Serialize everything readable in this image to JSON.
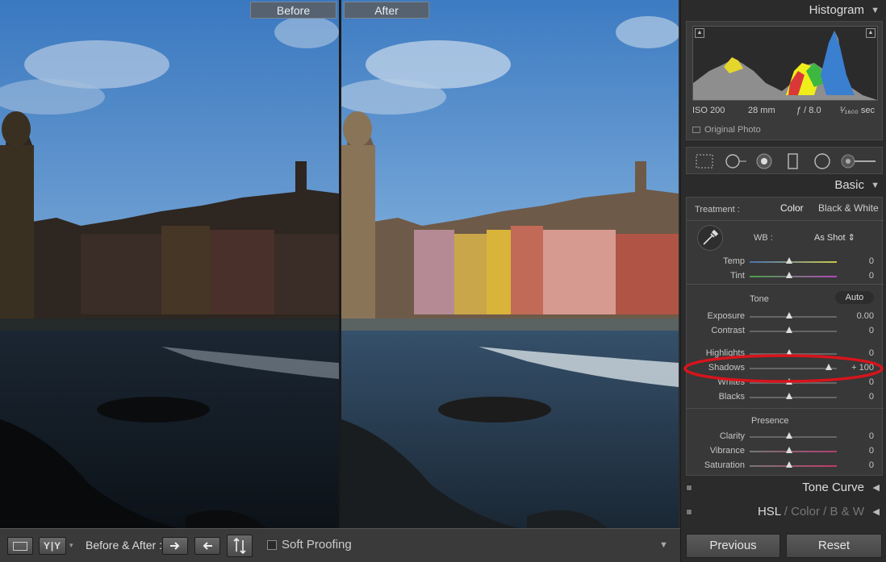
{
  "view": {
    "before_label": "Before",
    "after_label": "After"
  },
  "toolbar": {
    "yy_label": "Y|Y",
    "dropdown_glyph": "▾",
    "before_after_label": "Before & After :",
    "soft_proofing_label": "Soft Proofing",
    "menu_glyph": "▼"
  },
  "histogram": {
    "title": "Histogram",
    "collapse_glyph": "▼",
    "iso": "ISO 200",
    "focal": "28 mm",
    "aperture": "ƒ / 8.0",
    "shutter": "¹⁄₁₆₀₀ sec",
    "original_photo": "Original Photo"
  },
  "basic": {
    "title": "Basic",
    "collapse_glyph": "▼",
    "treatment_label": "Treatment :",
    "treatment_color": "Color",
    "treatment_bw": "Black & White",
    "wb_label": "WB :",
    "wb_value": "As Shot ⇕",
    "tone_label": "Tone",
    "auto_label": "Auto",
    "presence_label": "Presence",
    "sliders": [
      {
        "label": "Temp",
        "value": "0",
        "pos": 0.5,
        "track": "temp"
      },
      {
        "label": "Tint",
        "value": "0",
        "pos": 0.5,
        "track": "tint"
      },
      {
        "label": "Exposure",
        "value": "0.00",
        "pos": 0.5,
        "track": "plain"
      },
      {
        "label": "Contrast",
        "value": "0",
        "pos": 0.5,
        "track": "plain"
      },
      {
        "label": "Highlights",
        "value": "0",
        "pos": 0.5,
        "track": "plain"
      },
      {
        "label": "Shadows",
        "value": "+ 100",
        "pos": 1.0,
        "track": "plain"
      },
      {
        "label": "Whites",
        "value": "0",
        "pos": 0.5,
        "track": "plain"
      },
      {
        "label": "Blacks",
        "value": "0",
        "pos": 0.5,
        "track": "plain"
      },
      {
        "label": "Clarity",
        "value": "0",
        "pos": 0.5,
        "track": "plain"
      },
      {
        "label": "Vibrance",
        "value": "0",
        "pos": 0.5,
        "track": "vib"
      },
      {
        "label": "Saturation",
        "value": "0",
        "pos": 0.5,
        "track": "sat"
      }
    ]
  },
  "panels": {
    "tone_curve": "Tone Curve",
    "tone_curve_glyph": "◀",
    "hsl": "HSL",
    "hsl_sep": "/",
    "color": "Color",
    "bw": "B & W",
    "hsl_glyph": "◀"
  },
  "buttons": {
    "previous": "Previous",
    "reset": "Reset"
  },
  "colors": {
    "annotation": "#d8141c",
    "panel_bg": "#2b2b2b",
    "label_bg": "#566270"
  }
}
